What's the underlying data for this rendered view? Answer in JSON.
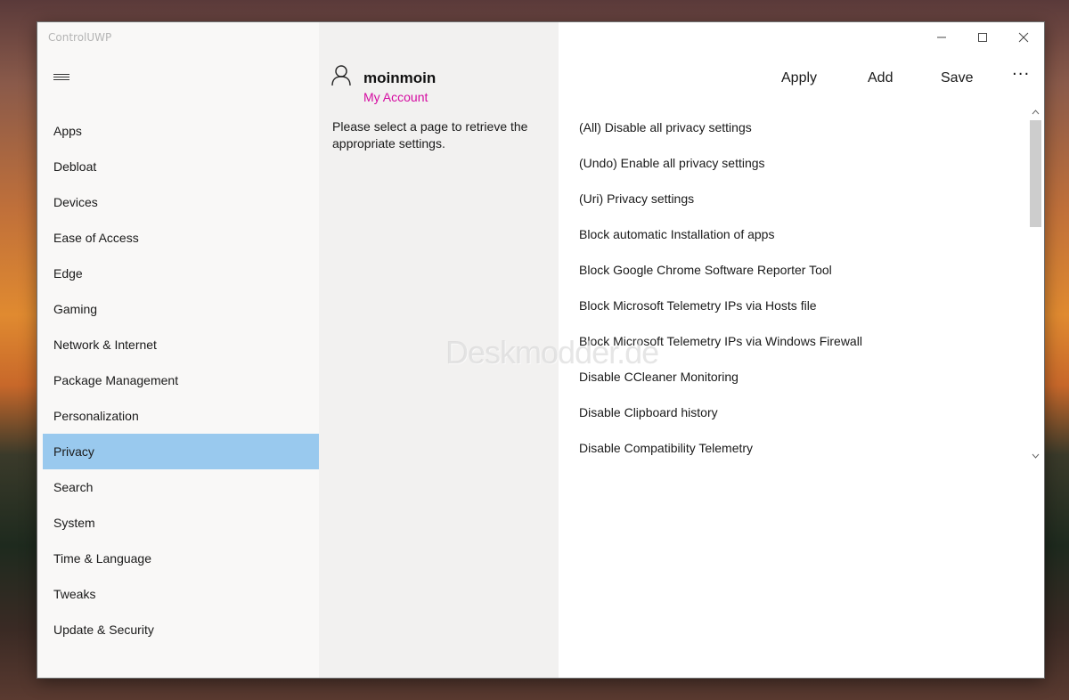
{
  "window": {
    "title": "ControlUWP"
  },
  "sidebar": {
    "menu_icon": "hamburger-icon",
    "items": [
      {
        "label": "Apps",
        "selected": false
      },
      {
        "label": "Debloat",
        "selected": false
      },
      {
        "label": "Devices",
        "selected": false
      },
      {
        "label": "Ease of Access",
        "selected": false
      },
      {
        "label": "Edge",
        "selected": false
      },
      {
        "label": "Gaming",
        "selected": false
      },
      {
        "label": "Network & Internet",
        "selected": false
      },
      {
        "label": "Package Management",
        "selected": false
      },
      {
        "label": "Personalization",
        "selected": false
      },
      {
        "label": "Privacy",
        "selected": true
      },
      {
        "label": "Search",
        "selected": false
      },
      {
        "label": "System",
        "selected": false
      },
      {
        "label": "Time & Language",
        "selected": false
      },
      {
        "label": "Tweaks",
        "selected": false
      },
      {
        "label": "Update & Security",
        "selected": false
      }
    ]
  },
  "account": {
    "icon": "user-icon",
    "username": "moinmoin",
    "link_label": "My Account",
    "info": "Please select a page to retrieve the appropriate settings."
  },
  "toolbar": {
    "apply_label": "Apply",
    "add_label": "Add",
    "save_label": "Save",
    "more_label": "···"
  },
  "content": {
    "items": [
      "(All) Disable all privacy settings",
      "(Undo) Enable all privacy settings",
      "(Uri) Privacy settings",
      "Block automatic Installation of apps",
      "Block Google Chrome Software Reporter Tool",
      "Block Microsoft Telemetry IPs via Hosts file",
      "Block Microsoft Telemetry IPs via Windows Firewall",
      "Disable CCleaner Monitoring",
      "Disable Clipboard history",
      "Disable Compatibility Telemetry"
    ]
  },
  "watermark": "Deskmodder.de",
  "colors": {
    "selection": "#99c9ee",
    "accent_link": "#d50aa1",
    "sidebar_bg": "#f9f8f7",
    "middle_bg": "#f2f1f0"
  }
}
